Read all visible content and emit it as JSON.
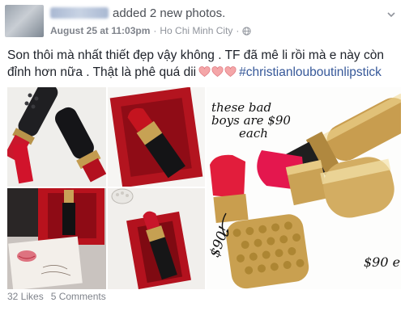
{
  "post": {
    "action": "added 2 new photos.",
    "date": "August 25 at 11:03pm",
    "separator": "·",
    "location": "Ho Chi Minh City",
    "location_separator": "·",
    "text_main": "Son thôi mà nhất thiết đẹp vậy không . TF đã mê li rồi mà e này còn đỉnh hơn nữa . Thật là phê quá dii",
    "hashtag": "#christianlouboutinlipstick",
    "heart_color": "#f4a6a8",
    "link_color": "#365899"
  },
  "photos": {
    "annotation_top": "these bad boys are $90 each",
    "annotation_left": "$90!",
    "annotation_right": "$90 e"
  },
  "footer": {
    "likes": "32 Likes",
    "comments": "5 Comments"
  },
  "icons": [
    "globe-icon",
    "chevron-down-icon",
    "heart-icon"
  ]
}
